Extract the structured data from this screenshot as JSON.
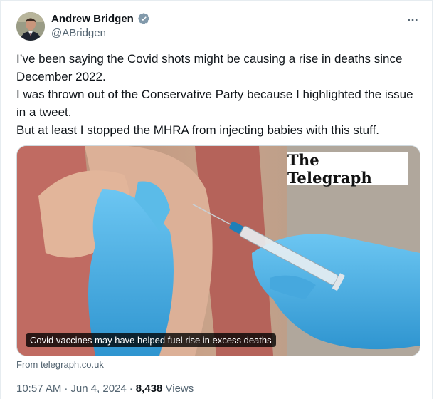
{
  "author": {
    "name": "Andrew Bridgen",
    "handle": "@ABridgen",
    "verified_badge_color": "#829aab"
  },
  "icons": {
    "verified": "verified-badge-icon",
    "more": "more-horizontal-icon"
  },
  "tweet": {
    "lines": [
      "I’ve been saying the Covid shots might be causing a rise in deaths since December 2022.",
      "I was thrown out of the Conservative Party because I highlighted the issue in a tweet.",
      "But at least I stopped the MHRA from injecting babies with this stuff."
    ]
  },
  "card": {
    "logo_text": "The Telegraph",
    "caption": "Covid vaccines may have helped fuel rise in excess deaths",
    "source": "From telegraph.co.uk"
  },
  "meta": {
    "time": "10:57 AM",
    "date": "Jun 4, 2024",
    "views_count": "8,438",
    "views_label": "Views",
    "separator": "·"
  },
  "colors": {
    "text_primary": "#0f1419",
    "text_secondary": "#536471",
    "glove_blue": "#4fb3e8"
  }
}
